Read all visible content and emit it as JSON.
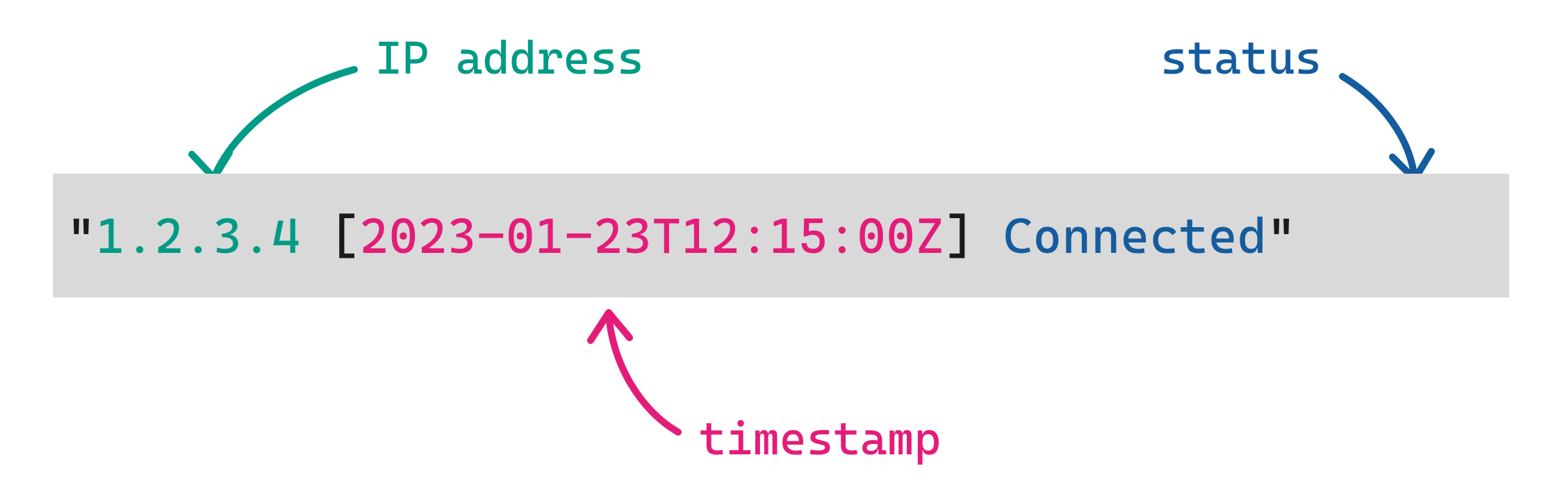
{
  "labels": {
    "ip": "IP address",
    "status": "status",
    "timestamp": "timestamp"
  },
  "log": {
    "quote_open": "\"",
    "ip": "1.2.3.4",
    "bracket_open": "[",
    "timestamp": "2023-01-23T12:15:00Z",
    "bracket_close": "]",
    "status": "Connected",
    "quote_close": "\""
  },
  "colors": {
    "ip": "#009b86",
    "status": "#145c9e",
    "timestamp": "#e31c79",
    "box_bg": "#d9d9d9"
  }
}
